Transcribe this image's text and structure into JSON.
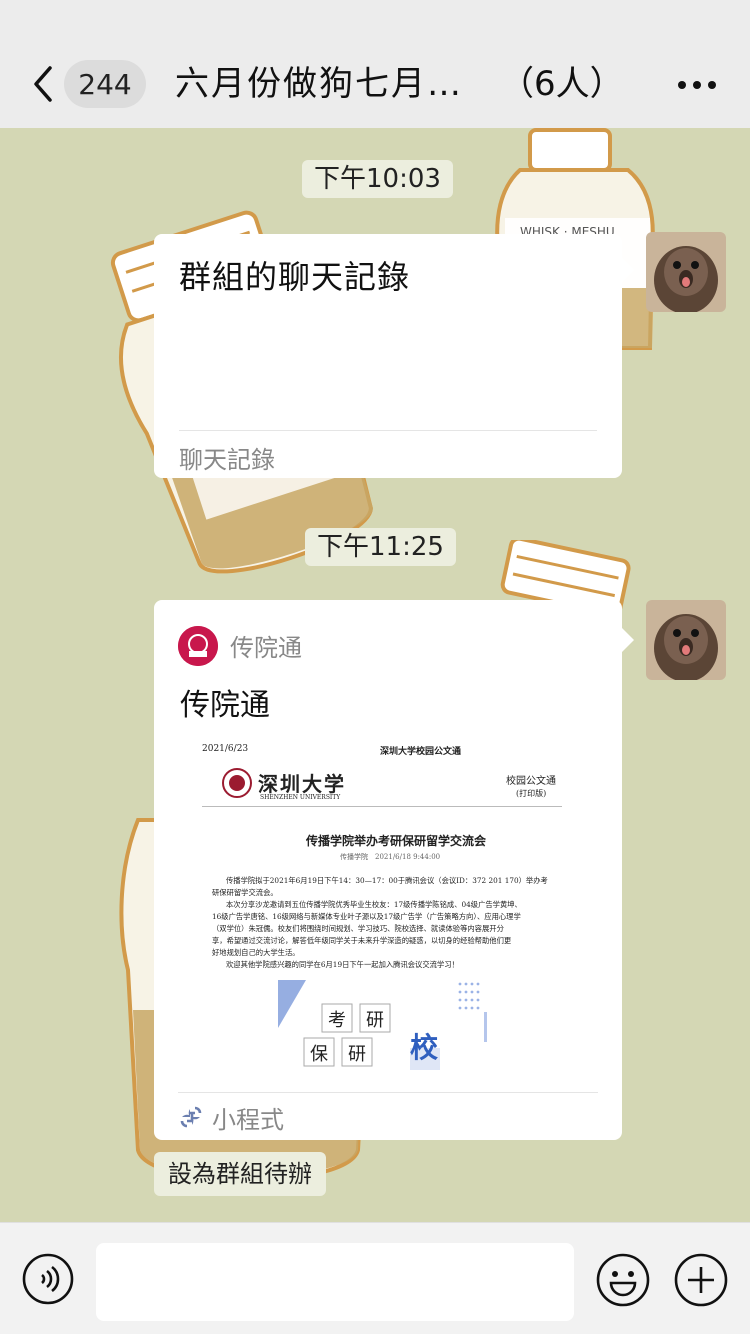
{
  "header": {
    "unread_count": "244",
    "title": "六月份做狗七月…",
    "members": "（6人）"
  },
  "messages": [
    {
      "time": "下午10:03",
      "type": "chat-record",
      "title": "群組的聊天記錄",
      "footer": "聊天記錄"
    },
    {
      "time": "下午11:25",
      "type": "mini-program",
      "source": "传院通",
      "title": "传院通",
      "footer": "小程式",
      "preview": {
        "date": "2021/6/23",
        "header_title": "深圳大学校园公文通",
        "university_cn": "深圳大学",
        "university_en": "SHENZHEN UNIVERSITY",
        "category": "校园公文通",
        "print_label": "(打印版)",
        "article_title": "传播学院举办考研保研留学交流会",
        "meta": "传播学院　2021/6/18 9:44:00",
        "body_lines": [
          "传播学院拟于2021年6月19日下午14：30—17：00于腾讯会议（会议ID：372 201 170）举办考",
          "研保研留学交流会。",
          "本次分享沙龙邀请到五位传播学院优秀毕业生校友：17级传播学陈铭成、04级广告学黄坤、",
          "16级广告学唐铭、16级网络与新媒体专业叶子源以及17级广告学（广告策略方向）、应用心理学",
          "（双学位）朱冠儒。校友们将围绕时间规划、学习技巧、院校选择、就读体验等内容展开分",
          "享，希望通过交流讨论，解答低年级同学关于未来升学深造的疑惑，以切身的经验帮助他们更",
          "好地规划自己的大学生活。",
          "欢迎其他学院感兴趣的同学在6月19日下午一起加入腾讯会议交流学习！"
        ],
        "poster_words": [
          "考",
          "研",
          "保",
          "研",
          "校"
        ]
      }
    }
  ],
  "todo_label": "設為群組待辦",
  "colors": {
    "chat_background": "#d4d7b4",
    "header_background": "#ececec",
    "logo_red": "#c8174c"
  }
}
